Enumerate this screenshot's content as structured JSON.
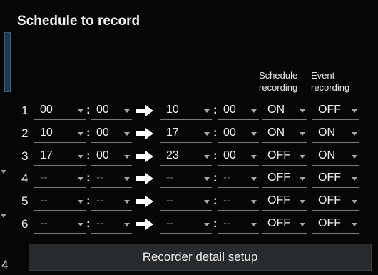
{
  "title": "Schedule to record",
  "headers": {
    "schedule_recording": [
      "Schedule",
      "recording"
    ],
    "event_recording": [
      "Event",
      "recording"
    ]
  },
  "rows": [
    {
      "num": "1",
      "start_h": "00",
      "start_m": "00",
      "end_h": "10",
      "end_m": "00",
      "schedule": "ON",
      "event": "OFF"
    },
    {
      "num": "2",
      "start_h": "10",
      "start_m": "00",
      "end_h": "17",
      "end_m": "00",
      "schedule": "ON",
      "event": "ON"
    },
    {
      "num": "3",
      "start_h": "17",
      "start_m": "00",
      "end_h": "23",
      "end_m": "00",
      "schedule": "OFF",
      "event": "ON"
    },
    {
      "num": "4",
      "start_h": "--",
      "start_m": "--",
      "end_h": "--",
      "end_m": "--",
      "schedule": "OFF",
      "event": "OFF"
    },
    {
      "num": "5",
      "start_h": "--",
      "start_m": "--",
      "end_h": "--",
      "end_m": "--",
      "schedule": "OFF",
      "event": "OFF"
    },
    {
      "num": "6",
      "start_h": "--",
      "start_m": "--",
      "end_h": "--",
      "end_m": "--",
      "schedule": "OFF",
      "event": "OFF"
    }
  ],
  "time_separator": ":",
  "detail_button": "Recorder detail setup",
  "side_number": "4",
  "icons": {
    "range": "right-arrow-icon",
    "dropdown": "chevron-down-icon"
  }
}
